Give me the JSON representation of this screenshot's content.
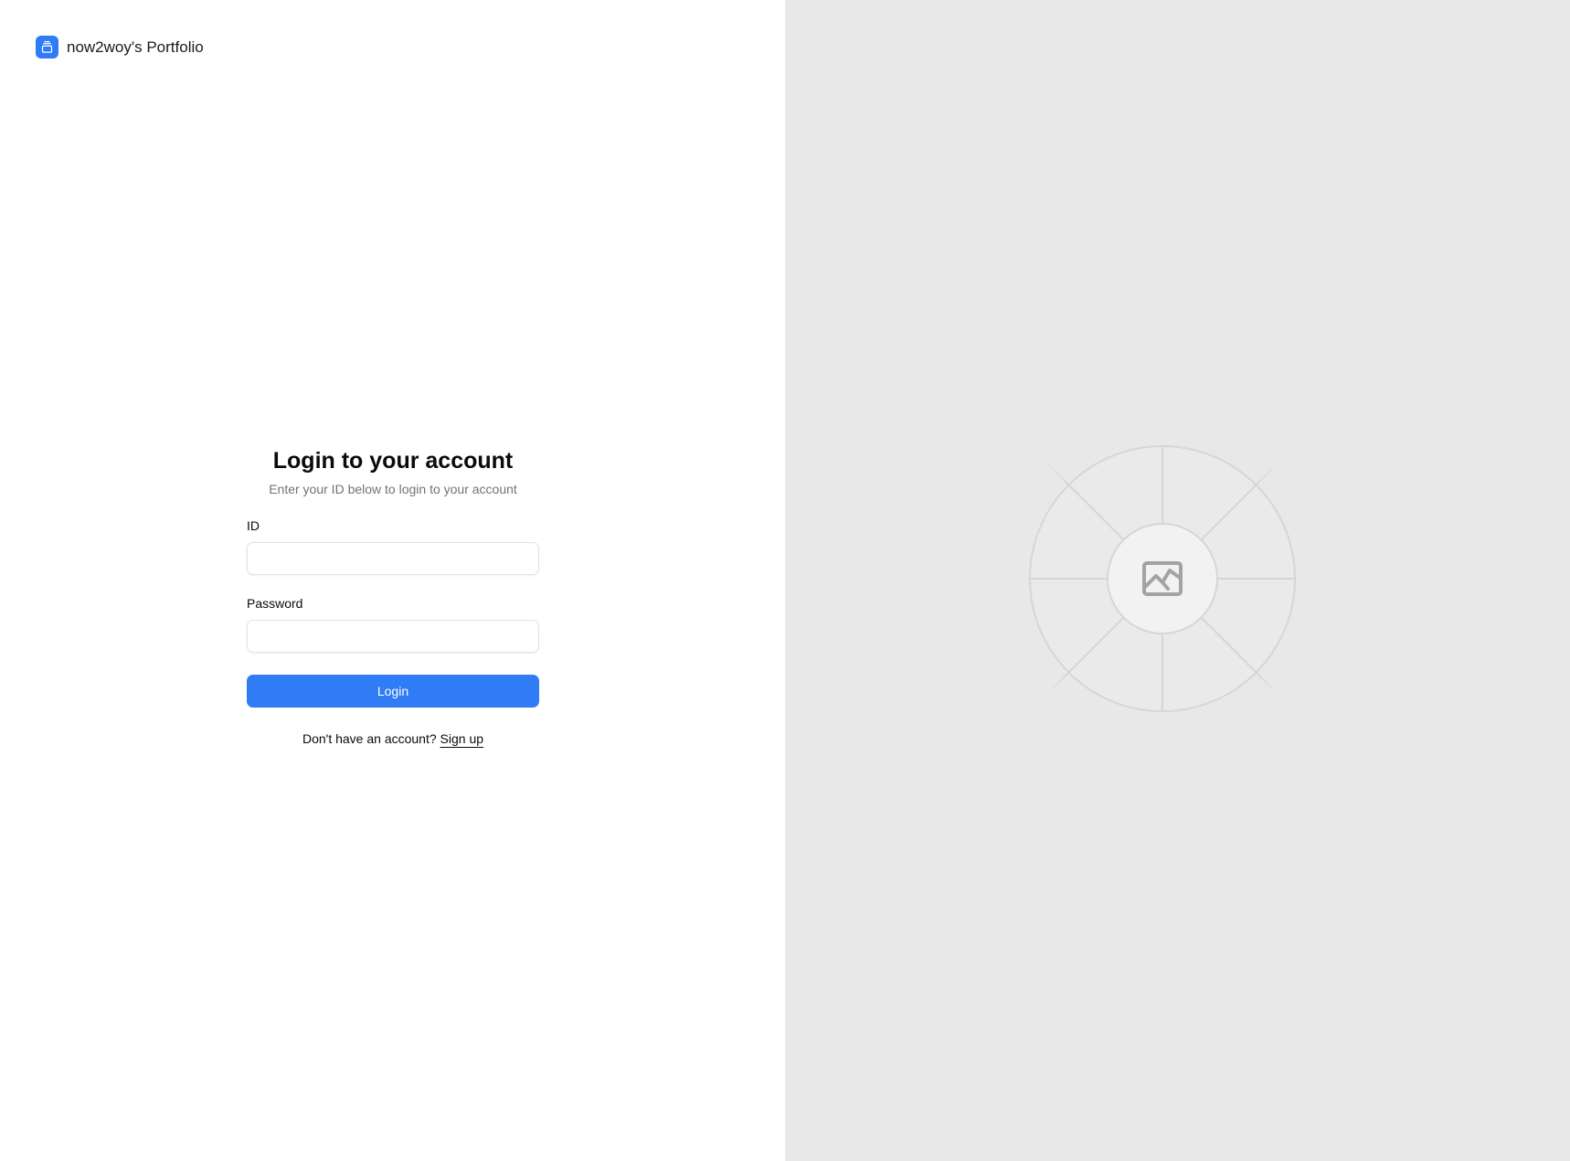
{
  "brand": {
    "name": "now2woy's Portfolio",
    "icon": "gallery-stack-icon"
  },
  "login": {
    "title": "Login to your account",
    "subtitle": "Enter your ID below to login to your account",
    "id_label": "ID",
    "id_value": "",
    "password_label": "Password",
    "password_value": "",
    "submit_label": "Login",
    "signup_prompt": "Don't have an account?",
    "signup_link": "Sign up"
  },
  "side_panel": {
    "image_icon": "image-placeholder-icon"
  },
  "colors": {
    "accent": "#2f7cf6",
    "panel_background": "#e8e8e8",
    "muted_text": "#737373"
  }
}
